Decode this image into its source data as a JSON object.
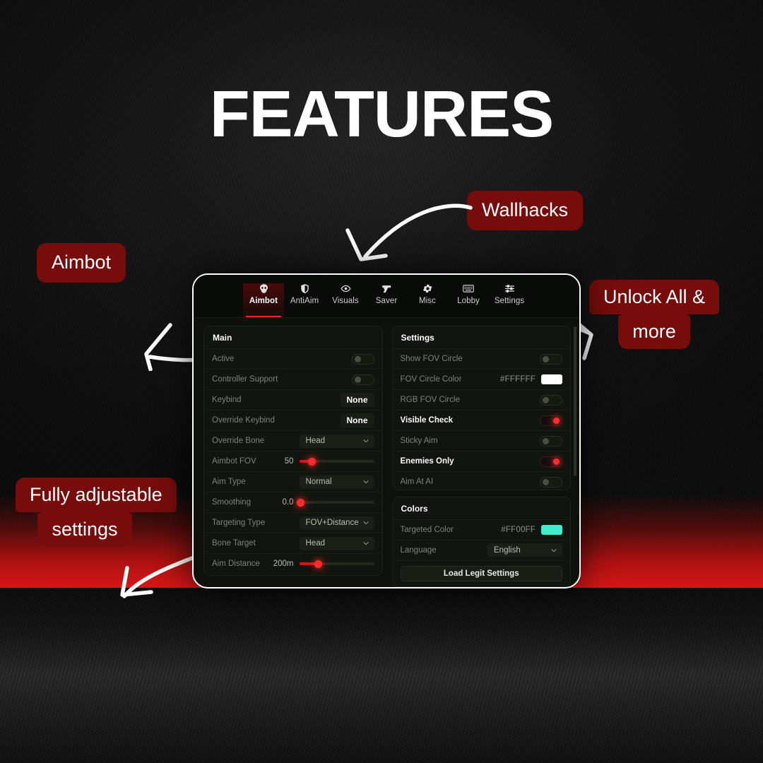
{
  "page": {
    "heading": "FEATURES",
    "accent_red": "#760c0c",
    "toggle_on_color": "#ff2b2b",
    "slider_color": "#cf1717"
  },
  "callouts": {
    "aimbot": "Aimbot",
    "wallhacks": "Wallhacks",
    "unlock_line1": "Unlock All &",
    "unlock_line2": "more",
    "settings_line1": "Fully adjustable",
    "settings_line2": "settings"
  },
  "menu": {
    "tabs": [
      {
        "label": "Aimbot",
        "icon": "skull-icon",
        "active": true
      },
      {
        "label": "AntiAim",
        "icon": "shield-icon",
        "active": false
      },
      {
        "label": "Visuals",
        "icon": "eye-icon",
        "active": false
      },
      {
        "label": "Saver",
        "icon": "pistol-icon",
        "active": false
      },
      {
        "label": "Misc",
        "icon": "gear-icon",
        "active": false
      },
      {
        "label": "Lobby",
        "icon": "keyboard-icon",
        "active": false
      },
      {
        "label": "Settings",
        "icon": "sliders-icon",
        "active": false
      }
    ],
    "left_card": {
      "title": "Main",
      "rows": [
        {
          "label": "Active",
          "type": "toggle",
          "value": "off"
        },
        {
          "label": "Controller Support",
          "type": "toggle",
          "value": "off"
        },
        {
          "label": "Keybind",
          "type": "keybind",
          "value": "None"
        },
        {
          "label": "Override Keybind",
          "type": "keybind",
          "value": "None"
        },
        {
          "label": "Override Bone",
          "type": "dropdown",
          "value": "Head"
        },
        {
          "label": "Aimbot FOV",
          "type": "slider",
          "value": "50",
          "percent": 17
        },
        {
          "label": "Aim Type",
          "type": "dropdown",
          "value": "Normal"
        },
        {
          "label": "Smoothing",
          "type": "slider",
          "value": "0.0",
          "percent": 2
        },
        {
          "label": "Targeting Type",
          "type": "dropdown",
          "value": "FOV+Distance"
        },
        {
          "label": "Bone Target",
          "type": "dropdown",
          "value": "Head"
        },
        {
          "label": "Aim Distance",
          "type": "slider",
          "value": "200m",
          "percent": 25
        }
      ]
    },
    "right_card": {
      "title": "Settings",
      "rows": [
        {
          "label": "Show FOV Circle",
          "type": "toggle",
          "value": "off"
        },
        {
          "label": "FOV Circle Color",
          "type": "color",
          "value": "#FFFFFF",
          "swatch": "#FFFFFF"
        },
        {
          "label": "RGB FOV Circle",
          "type": "toggle",
          "value": "off"
        },
        {
          "label": "Visible Check",
          "type": "toggle",
          "value": "on"
        },
        {
          "label": "Sticky Aim",
          "type": "toggle",
          "value": "off"
        },
        {
          "label": "Enemies Only",
          "type": "toggle",
          "value": "on"
        },
        {
          "label": "Aim At AI",
          "type": "toggle",
          "value": "off"
        }
      ]
    },
    "colors_card": {
      "title": "Colors",
      "rows": [
        {
          "label": "Targeted Color",
          "type": "color",
          "value": "#FF00FF",
          "swatch": "#3FF0CD"
        },
        {
          "label": "Language",
          "type": "dropdown",
          "value": "English"
        }
      ],
      "button": "Load Legit Settings"
    }
  }
}
